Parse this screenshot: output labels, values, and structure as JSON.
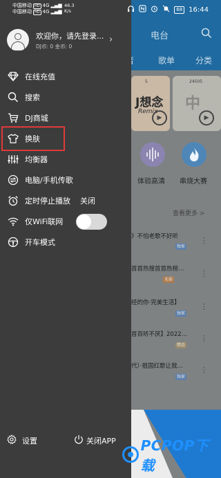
{
  "status_bar": {
    "carrier1": "中国移动",
    "carrier2": "中国移动",
    "hd_tag": "HD",
    "net": "4G",
    "speed_value": "46.3",
    "speed_unit": "K/s",
    "battery": "68",
    "time": "16:44"
  },
  "background_app": {
    "title": "电台",
    "tabs": [
      "者",
      "歌单",
      "分类"
    ],
    "cards": [
      {
        "text": "J想念",
        "sub": "Remix",
        "count": "5"
      },
      {
        "text": "中",
        "sub": "",
        "count": "24505"
      }
    ],
    "circles": [
      "体验高清",
      "串烧大赛"
    ],
    "more_label": "查看更多 >",
    "rows": [
      {
        "text": "》不怕老歌不好听",
        "badge": "独家"
      },
      {
        "text": "首首热搜首首热榜…",
        "badge": "无损"
      },
      {
        "text": "经的你·完美生活】",
        "badge": "独家"
      },
      {
        "text": "首百听不厌】2022…",
        "badge": "精品"
      },
      {
        "text": "代）·祖国红歌让我…",
        "badge": "独家"
      }
    ]
  },
  "drawer": {
    "profile": {
      "welcome": "欢迎你，请先登录...",
      "coins": "DJ币: 0 金币: 0"
    },
    "menu": [
      {
        "label": "在线充值",
        "extra": ""
      },
      {
        "label": "搜索",
        "extra": ""
      },
      {
        "label": "DJ商城",
        "extra": ""
      },
      {
        "label": "换肤",
        "extra": ""
      },
      {
        "label": "均衡器",
        "extra": ""
      },
      {
        "label": "电脑/手机传歌",
        "extra": ""
      },
      {
        "label": "定时停止播放",
        "extra": "关闭"
      },
      {
        "label": "仅WiFi联网",
        "extra": ""
      },
      {
        "label": "开车模式",
        "extra": ""
      }
    ],
    "wifi_only_enabled": false,
    "settings_label": "设置",
    "exit_label": "关闭APP"
  },
  "watermark": "PCPOP下载",
  "colors": {
    "drawer_bg": "#3c3c3c",
    "header_blue": "#1f6aa0",
    "highlight_red": "#e03a3a"
  }
}
